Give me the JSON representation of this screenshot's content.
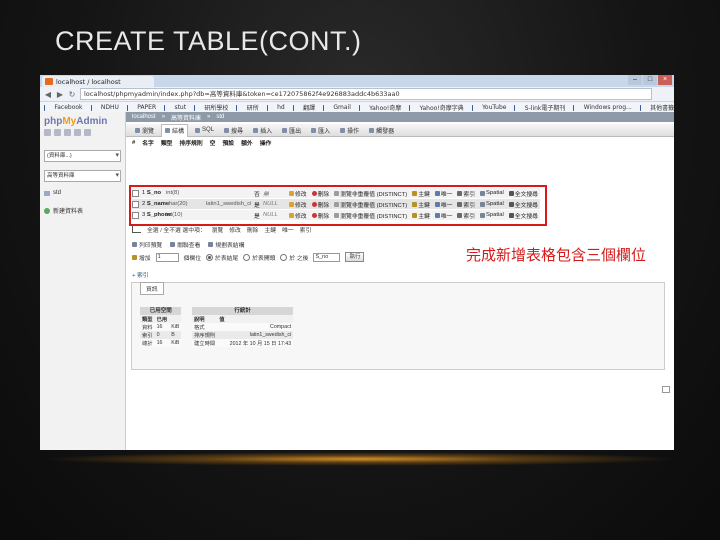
{
  "slide": {
    "title": "CREATE TABLE(CONT.)"
  },
  "browser": {
    "tab_title": "localhost / localhost",
    "url": "localhost/phpmyadmin/index.php?db=高等資料庫&token=ce172075862f4e926883addc4b633aa0",
    "bookmarks": [
      "Facebook",
      "NDHU",
      "PAPER",
      "stut",
      "研所學校",
      "研所",
      "hd",
      "翻譯",
      "Gmail",
      "Yahoo!奇摩",
      "Yahoo!奇摩字典",
      "YouTube",
      "S-link電子期刊",
      "Windows prog...",
      "其他書籤"
    ]
  },
  "pma": {
    "logo_text": "phpMyAdmin",
    "left": {
      "select1": "(資料庫...)",
      "select2": "高等資料庫",
      "tables": [
        "std"
      ],
      "new_table": "新建資料表"
    },
    "breadcrumb": [
      "localhost",
      "高等資料庫",
      "std"
    ],
    "tabs": [
      "瀏覽",
      "結構",
      "SQL",
      "搜尋",
      "插入",
      "匯出",
      "匯入",
      "操作",
      "觸發器"
    ],
    "columns_header": [
      "#",
      "名字",
      "類型",
      "排序規則",
      "空",
      "預設",
      "額外",
      "操作"
    ],
    "rows": [
      {
        "num": "1",
        "name": "S_no",
        "type": "int(8)",
        "coll": "",
        "null": "否",
        "default": "無"
      },
      {
        "num": "2",
        "name": "S_name",
        "type": "char(20)",
        "coll": "latin1_swedish_ci",
        "null": "是",
        "default": "NULL"
      },
      {
        "num": "3",
        "name": "S_phone",
        "type": "int(10)",
        "coll": "",
        "null": "是",
        "default": "NULL"
      }
    ],
    "row_actions": [
      "修改",
      "刪除",
      "瀏覽非重覆值 (DISTINCT)",
      "主鍵",
      "唯一",
      "索引",
      "Spatial",
      "全文搜尋"
    ],
    "select_bar": [
      "全選 / 全不選 選中項：",
      "瀏覽",
      "修改",
      "刪除",
      "主鍵",
      "唯一",
      "索引"
    ],
    "tool_row": [
      "列印預覽",
      "關聯查看",
      "規劃表結構"
    ],
    "add_row": {
      "add": "增加",
      "count": "1",
      "label_col": "個欄位",
      "opt1": "於表結尾",
      "opt2": "於表開頭",
      "opt3": "於 之後",
      "after_col": "S_no",
      "button": "執行"
    },
    "index_link": "+ 索引",
    "info_tab": "資訊",
    "space": {
      "header": "已用空間",
      "cols": [
        "類型",
        "已用"
      ],
      "rows": [
        [
          "資料",
          "16",
          "KiB"
        ],
        [
          "索引",
          "0",
          "B"
        ],
        [
          "總計",
          "16",
          "KiB"
        ]
      ]
    },
    "rowstats": {
      "header": "行統計",
      "cols": [
        "說明",
        "值"
      ],
      "rows": [
        [
          "格式",
          "Compact"
        ],
        [
          "排序規則",
          "latin1_swedish_ci"
        ],
        [
          "建立時間",
          "2012 年 10 月 15 日 17:43"
        ]
      ]
    }
  },
  "annotation": "完成新增表格包含三個欄位",
  "colors": {
    "highlight": "#d51a1a",
    "glow": "#da9628"
  }
}
